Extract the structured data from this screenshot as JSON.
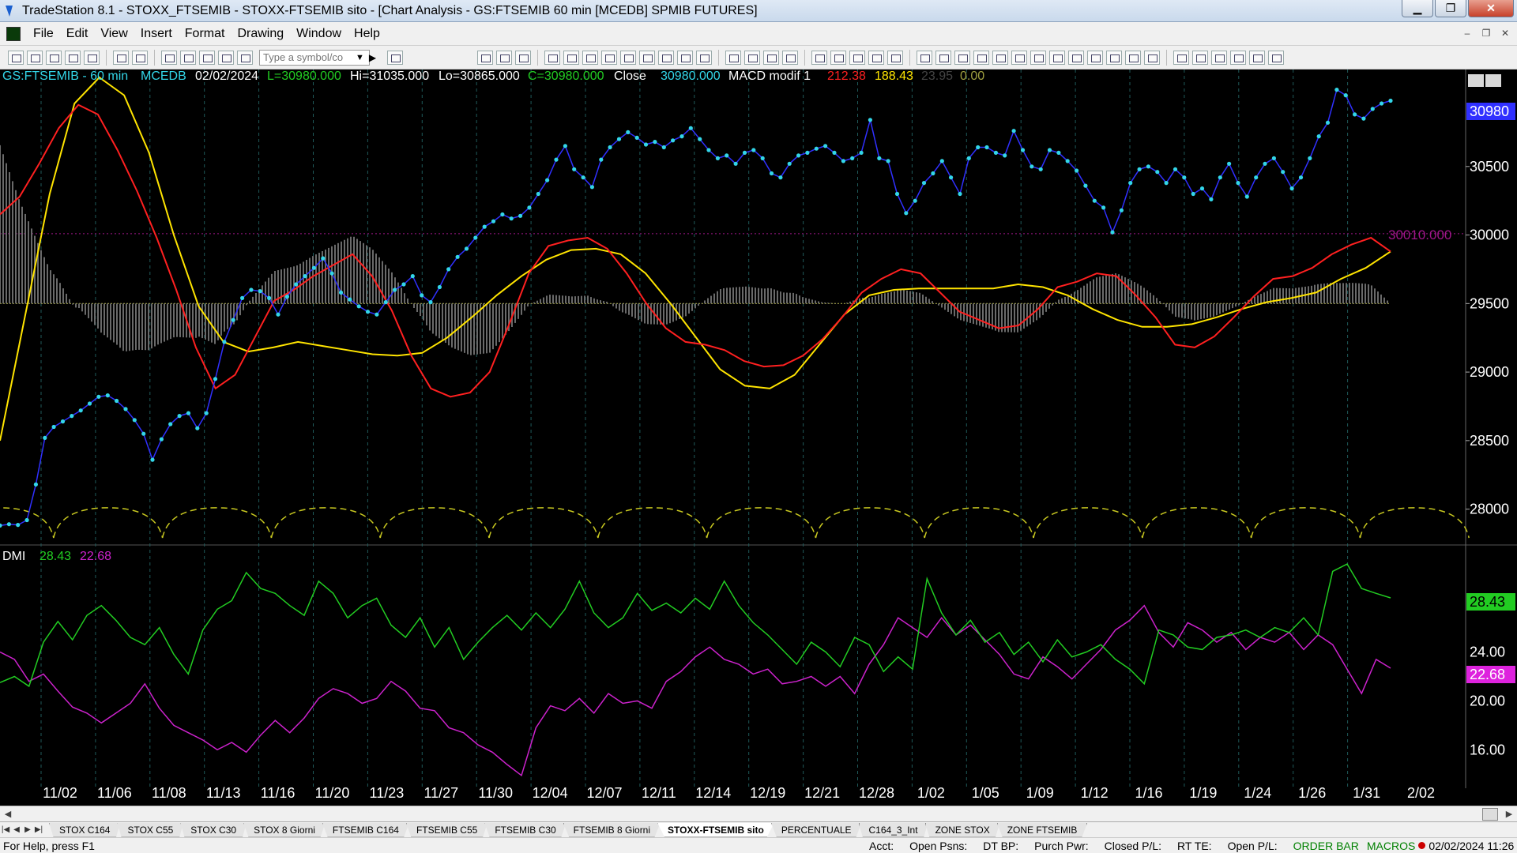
{
  "window": {
    "title": "TradeStation 8.1 - STOXX_FTSEMIB - STOXX-FTSEMIB sito - [Chart Analysis - GS:FTSEMIB  60 min  [MCEDB] SPMIB FUTURES]",
    "minimize": "▁",
    "restore": "❐",
    "close": "✕"
  },
  "menu": {
    "items": [
      "File",
      "Edit",
      "View",
      "Insert",
      "Format",
      "Drawing",
      "Window",
      "Help"
    ]
  },
  "toolbar": {
    "symbol_placeholder": "Type a symbol/co"
  },
  "colors": {
    "price": "#33d6e8",
    "price_close": "#3030ff",
    "macd_red": "#ff2020",
    "macd_yellow": "#ffe400",
    "histogram": "#6a6a6a",
    "ref_line": "#a0a040",
    "dmi_plus": "#22cc22",
    "dmi_minus": "#cc22cc",
    "cycle": "#c8c820",
    "axis_label": "#ffffff",
    "level_label": "#a0168a"
  },
  "chart_data": [
    {
      "type": "line",
      "panel": "price",
      "header": {
        "symbol": "GS:FTSEMIB - 60 min",
        "study": "MCEDB",
        "date": "02/02/2024",
        "last": "L=30980.000",
        "high": "Hi=31035.000",
        "low": "Lo=30865.000",
        "close_eq": "C=30980.000",
        "close_label": "Close",
        "close_value": "30980.000",
        "macd_name": "MACD modif 1",
        "macd_v1": "212.38",
        "macd_v2": "188.43",
        "macd_v3": "23.95",
        "macd_v4": "0.00"
      },
      "ylim": [
        27750,
        31150
      ],
      "y_ticks": [
        28000,
        28500,
        29000,
        29500,
        30000,
        30500
      ],
      "y_tick_labels": [
        "28000",
        "28500",
        "29000",
        "29500",
        "30000",
        "30500"
      ],
      "last_price_label": "30980",
      "level_line": {
        "value": 30010,
        "label": "30010.000"
      },
      "x_ticks": [
        "11/02",
        "11/06",
        "11/08",
        "11/13",
        "11/16",
        "11/20",
        "11/23",
        "11/27",
        "11/30",
        "12/04",
        "12/07",
        "12/11",
        "12/14",
        "12/19",
        "12/21",
        "12/28",
        "1/02",
        "1/05",
        "1/09",
        "1/12",
        "1/16",
        "1/19",
        "1/24",
        "1/26",
        "1/31",
        "2/02"
      ],
      "series": [
        {
          "key": "price",
          "values": [
            27880,
            27890,
            27885,
            27920,
            28180,
            28520,
            28600,
            28640,
            28680,
            28720,
            28770,
            28820,
            28830,
            28790,
            28730,
            28650,
            28550,
            28360,
            28510,
            28620,
            28680,
            28700,
            28590,
            28700,
            28950,
            29220,
            29380,
            29540,
            29600,
            29590,
            29540,
            29420,
            29550,
            29640,
            29700,
            29760,
            29830,
            29720,
            29580,
            29530,
            29480,
            29440,
            29420,
            29510,
            29600,
            29640,
            29700,
            29560,
            29510,
            29620,
            29750,
            29840,
            29900,
            29980,
            30060,
            30100,
            30150,
            30120,
            30140,
            30200,
            30300,
            30400,
            30550,
            30650,
            30480,
            30420,
            30350,
            30550,
            30640,
            30700,
            30750,
            30710,
            30660,
            30680,
            30640,
            30690,
            30720,
            30780,
            30700,
            30620,
            30560,
            30580,
            30520,
            30600,
            30620,
            30560,
            30450,
            30420,
            30520,
            30580,
            30600,
            30630,
            30650,
            30600,
            30540,
            30560,
            30600,
            30840,
            30560,
            30540,
            30300,
            30160,
            30250,
            30380,
            30450,
            30540,
            30420,
            30300,
            30560,
            30640,
            30640,
            30600,
            30580,
            30760,
            30620,
            30500,
            30480,
            30620,
            30600,
            30540,
            30470,
            30360,
            30250,
            30200,
            30020,
            30180,
            30380,
            30480,
            30500,
            30460,
            30380,
            30480,
            30420,
            30300,
            30340,
            30260,
            30420,
            30520,
            30380,
            30280,
            30420,
            30520,
            30560,
            30460,
            30340,
            30420,
            30560,
            30720,
            30820,
            31060,
            31020,
            30880,
            30850,
            30920,
            30960,
            30980
          ]
        },
        {
          "key": "macd_red",
          "values": [
            30150,
            30280,
            30520,
            30780,
            30950,
            30880,
            30620,
            30320,
            29980,
            29600,
            29180,
            28880,
            28980,
            29250,
            29520,
            29600,
            29700,
            29780,
            29860,
            29700,
            29450,
            29120,
            28880,
            28820,
            28850,
            29000,
            29350,
            29720,
            29920,
            29960,
            29980,
            29900,
            29720,
            29500,
            29320,
            29220,
            29200,
            29160,
            29080,
            29040,
            29050,
            29120,
            29240,
            29400,
            29580,
            29680,
            29750,
            29720,
            29580,
            29440,
            29380,
            29320,
            29340,
            29460,
            29620,
            29660,
            29720,
            29700,
            29560,
            29400,
            29200,
            29180,
            29260,
            29400,
            29550,
            29680,
            29700,
            29760,
            29860,
            29930,
            29980,
            29880
          ]
        },
        {
          "key": "macd_yellow",
          "values": [
            28500,
            29400,
            30300,
            30960,
            31150,
            31020,
            30600,
            30000,
            29480,
            29220,
            29150,
            29180,
            29220,
            29190,
            29160,
            29130,
            29120,
            29140,
            29250,
            29400,
            29560,
            29700,
            29820,
            29890,
            29900,
            29860,
            29720,
            29500,
            29260,
            29020,
            28900,
            28880,
            28980,
            29200,
            29420,
            29560,
            29600,
            29610,
            29610,
            29610,
            29610,
            29640,
            29620,
            29560,
            29460,
            29380,
            29330,
            29330,
            29350,
            29400,
            29460,
            29510,
            29540,
            29580,
            29680,
            29760,
            29880
          ]
        }
      ]
    },
    {
      "type": "line",
      "panel": "dmi",
      "name": "DMI",
      "ylim": [
        13.5,
        32.5
      ],
      "y_ticks": [
        16,
        20,
        24
      ],
      "y_tick_labels": [
        "16.00",
        "20.00",
        "24.00"
      ],
      "series": [
        {
          "name": "28.43",
          "key": "dmi_plus",
          "last_label": "28.43",
          "values": [
            21.5,
            22.0,
            21.2,
            24.8,
            26.5,
            25.0,
            27.0,
            27.8,
            26.6,
            25.2,
            24.6,
            26.0,
            23.8,
            22.2,
            25.8,
            27.5,
            28.2,
            30.5,
            29.2,
            28.8,
            27.8,
            27.0,
            29.8,
            28.8,
            26.8,
            27.8,
            28.4,
            26.2,
            25.2,
            26.8,
            24.4,
            26.0,
            23.4,
            24.8,
            26.0,
            27.0,
            25.8,
            27.2,
            26.0,
            27.5,
            29.8,
            27.2,
            26.0,
            26.8,
            28.8,
            27.4,
            28.0,
            27.2,
            28.4,
            27.5,
            29.8,
            27.8,
            26.4,
            25.4,
            24.2,
            23.0,
            24.8,
            24.0,
            22.8,
            25.2,
            24.6,
            22.4,
            23.6,
            22.6,
            30.0,
            27.2,
            25.4,
            26.6,
            24.8,
            25.6,
            23.8,
            24.8,
            23.2,
            25.0,
            23.6,
            24.0,
            24.6,
            23.4,
            22.6,
            21.4,
            25.8,
            25.4,
            24.4,
            24.2,
            25.2,
            25.4,
            25.8,
            25.2,
            26.0,
            25.6,
            26.8,
            25.4,
            30.6,
            31.2,
            29.2,
            28.8,
            28.43
          ]
        },
        {
          "name": "22.68",
          "key": "dmi_minus",
          "last_label": "22.68",
          "values": [
            24.0,
            23.4,
            21.6,
            22.2,
            20.8,
            19.5,
            19.0,
            18.2,
            19.0,
            19.8,
            21.4,
            19.4,
            18.0,
            17.4,
            16.8,
            16.0,
            16.6,
            15.8,
            17.2,
            18.4,
            17.4,
            18.6,
            20.2,
            21.0,
            20.6,
            19.8,
            20.2,
            21.6,
            20.8,
            19.4,
            19.2,
            17.8,
            17.4,
            16.4,
            15.8,
            14.8,
            13.9,
            17.8,
            19.6,
            19.2,
            20.2,
            19.0,
            20.6,
            19.8,
            20.0,
            19.4,
            21.6,
            22.4,
            23.6,
            24.4,
            23.4,
            23.0,
            22.2,
            22.6,
            21.4,
            21.6,
            22.0,
            21.2,
            22.0,
            20.6,
            23.0,
            24.6,
            26.8,
            26.0,
            25.2,
            26.8,
            25.4,
            26.2,
            25.0,
            23.8,
            22.2,
            21.8,
            23.6,
            22.8,
            21.8,
            23.0,
            24.2,
            25.8,
            26.6,
            27.8,
            25.6,
            24.4,
            26.4,
            25.8,
            24.8,
            25.6,
            24.2,
            25.2,
            24.8,
            25.6,
            24.2,
            25.4,
            24.6,
            22.6,
            20.6,
            23.4,
            22.68
          ]
        }
      ]
    }
  ],
  "tabs": [
    "STOX C164",
    "STOX C55",
    "STOX  C30",
    "STOX  8 Giorni",
    "FTSEMIB C164",
    "FTSEMIB C55",
    "FTSEMIB C30",
    "FTSEMIB  8 Giorni",
    "STOXX-FTSEMIB sito",
    "PERCENTUALE",
    "C164_3_Int",
    "ZONE STOX",
    "ZONE FTSEMIB"
  ],
  "active_tab": "STOXX-FTSEMIB sito",
  "tab_nav": [
    "|◀",
    "◀",
    "▶",
    "▶|"
  ],
  "status": {
    "help": "For Help, press F1",
    "acct": "Acct:",
    "open_psns": "Open Psns:",
    "dt_bp": "DT BP:",
    "purch_pwr": "Purch Pwr:",
    "closed_pl": "Closed P/L:",
    "rt_te": "RT TE:",
    "open_pl": "Open P/L:",
    "order_bar": "ORDER BAR",
    "macros": "MACROS",
    "datetime": "02/02/2024 11:26"
  }
}
